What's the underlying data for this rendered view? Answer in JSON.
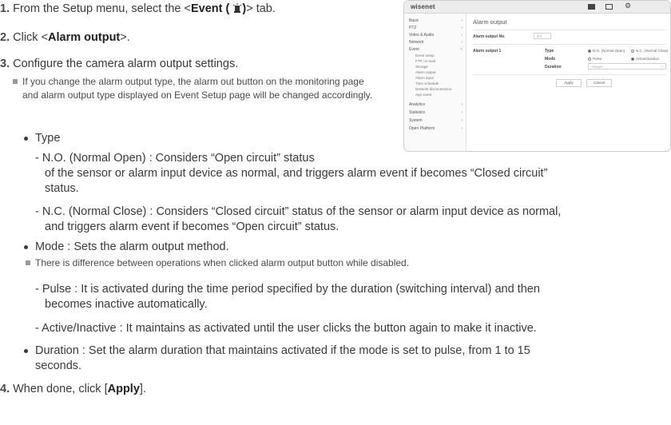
{
  "steps": {
    "s1": {
      "num": "1.",
      "pre": "From the Setup menu, select the <",
      "bold": "Event (",
      "icon": "event-icon",
      "bold2": ")",
      "post": "> tab."
    },
    "s2": {
      "num": "2.",
      "pre": "Click <",
      "bold": "Alarm output",
      "post": ">."
    },
    "s3": {
      "num": "3.",
      "text": "Configure the camera alarm output settings."
    },
    "note1": "If you change the alarm output type, the alarm out button on the monitoring page and alarm output type displayed on Event Setup page will be changed accordingly.",
    "type_label": "Type",
    "no_line1": "-  N.O. (Normal Open) : Considers “Open circuit” status",
    "no_line2": "of the sensor or alarm input device as normal, and triggers alarm event if becomes “Closed circuit”",
    "no_line3": "status.",
    "nc_line1": "-  N.C. (Normal Close) : Considers “Closed circuit” status of the sensor or alarm input device as normal,",
    "nc_line2": "and triggers alarm event if becomes “Open circuit” status.",
    "mode": "Mode : Sets the alarm output method.",
    "note2": "There is difference between operations when clicked alarm output button while disabled.",
    "pulse_line1": "-  Pulse : It is activated during the time period specified by the duration (switching interval) and then",
    "pulse_line2": "becomes inactive automatically.",
    "active_line": "-  Active/Inactive : It maintains as activated until the user clicks the button again to make it inactive.",
    "duration_line1": "Duration : Set the alarm duration that maintains activated if the mode is set to pulse, from 1 to 15",
    "duration_line2": "seconds.",
    "s4": {
      "num": "4.",
      "pre": "When done, click [",
      "bold": "Apply",
      "post": "]."
    }
  },
  "screenshot": {
    "logo": "wisenet",
    "page_title": "Alarm output",
    "sidebar": [
      {
        "label": "Basic",
        "chev": "›"
      },
      {
        "label": "PTZ",
        "chev": "›"
      },
      {
        "label": "Video & Audio",
        "chev": "›"
      },
      {
        "label": "Network",
        "chev": "›"
      },
      {
        "label": "Event",
        "chev": "˅"
      }
    ],
    "event_sub": [
      "Event setup",
      "FTP / E-mail",
      "Storage",
      "Alarm output",
      "Alarm input",
      "Time schedule",
      "Network disconnection",
      "App event"
    ],
    "sidebar_bottom": [
      {
        "label": "Analytics",
        "chev": "›"
      },
      {
        "label": "Statistics",
        "chev": "›"
      },
      {
        "label": "System",
        "chev": "›"
      },
      {
        "label": "Open Platform",
        "chev": "›"
      }
    ],
    "alarm_no_label": "Alarm output No.",
    "alarm_no_value": "1",
    "alarm1_label": "Alarm output 1",
    "type_label": "Type",
    "type_opt1": "N.O. (Normal Open)",
    "type_opt2": "N.C. (Normal Close)",
    "mode_label": "Mode",
    "mode_opt1": "Pulse",
    "mode_opt2": "Active/Inactive",
    "duration_label": "Duration",
    "duration_value": "Always",
    "apply": "Apply",
    "cancel": "Cancel"
  }
}
